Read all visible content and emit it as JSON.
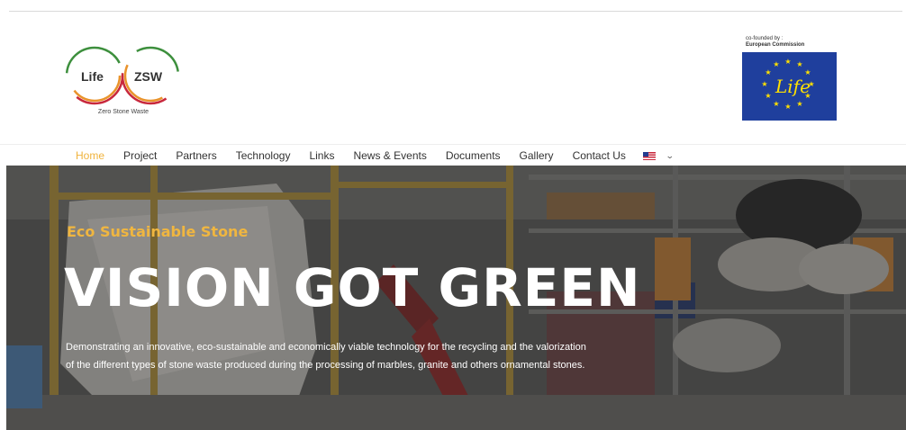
{
  "header": {
    "logo": {
      "left_text": "Life",
      "right_text": "ZSW",
      "caption": "Zero Stone Waste",
      "colors": {
        "red": "#c8283c",
        "orange": "#e9932b",
        "green": "#3d8f3d"
      }
    },
    "eu_badge": {
      "line1": "co-founded by :",
      "line2": "European Commission",
      "flag_text": "Life",
      "colors": {
        "blue": "#1f3f9d",
        "yellow": "#ffe000"
      }
    }
  },
  "nav": {
    "items": [
      {
        "label": "Home",
        "active": true
      },
      {
        "label": "Project"
      },
      {
        "label": "Partners"
      },
      {
        "label": "Technology"
      },
      {
        "label": "Links"
      },
      {
        "label": "News & Events"
      },
      {
        "label": "Documents"
      },
      {
        "label": "Gallery"
      },
      {
        "label": "Contact Us"
      }
    ],
    "language": {
      "icon": "us-flag-icon",
      "dropdown_icon": "chevron-down-icon"
    },
    "active_color": "#f0b33d"
  },
  "hero": {
    "kicker": "Eco Sustainable Stone",
    "title": "VISION GOT GREEN",
    "description": "Demonstrating an innovative, eco-sustainable and economically viable technology for the recycling and the valorization of the different types of stone waste produced during the processing of marbles, granite and others ornamental stones.",
    "kicker_color": "#f0b640"
  }
}
